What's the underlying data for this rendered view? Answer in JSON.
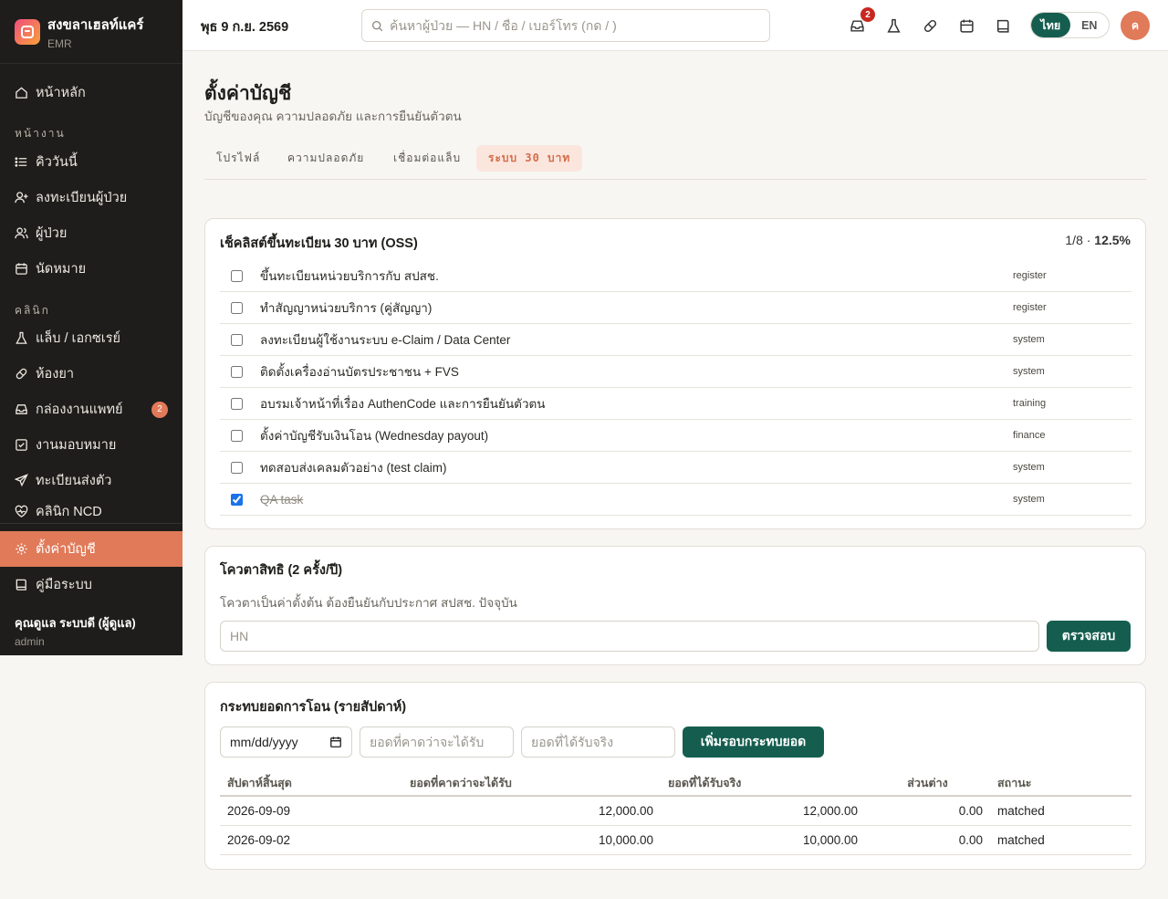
{
  "brand": {
    "name": "สงขลาเฮลท์แคร์",
    "sub": "EMR"
  },
  "sidebar": {
    "home": "หน้าหลัก",
    "section_work": "หน้างาน",
    "work_items": [
      "คิววันนี้",
      "ลงทะเบียนผู้ป่วย",
      "ผู้ป่วย",
      "นัดหมาย"
    ],
    "section_clinic": "คลินิก",
    "clinic_items": [
      "แล็บ / เอกซเรย์",
      "ห้องยา",
      "กล่องงานแพทย์",
      "งานมอบหมาย",
      "ทะเบียนส่งตัว",
      "คลินิก NCD"
    ],
    "inbox_badge": "2",
    "settings": "ตั้งค่าบัญชี",
    "manual": "คู่มือระบบ",
    "user_name": "คุณดูแล ระบบดี (ผู้ดูแล)",
    "user_role": "admin"
  },
  "topbar": {
    "date": "พุธ 9 ก.ย. 2569",
    "search_placeholder": "ค้นหาผู้ป่วย — HN / ชื่อ / เบอร์โทร (กด / )",
    "inbox_badge": "2",
    "lang_th": "ไทย",
    "lang_en": "EN",
    "avatar": "ค"
  },
  "page": {
    "title": "ตั้งค่าบัญชี",
    "subtitle": "บัญชีของคุณ ความปลอดภัย และการยืนยันตัวตน",
    "tabs": [
      "โปรไฟล์",
      "ความปลอดภัย",
      "เชื่อมต่อแล็บ",
      "ระบบ 30 บาท"
    ]
  },
  "checklist": {
    "title": "เช็คลิสต์ขึ้นทะเบียน 30 บาท (OSS)",
    "progress_count": "1/8 ·",
    "progress_pct": "12.5%",
    "items": [
      {
        "label": "ขึ้นทะเบียนหน่วยบริการกับ สปสช.",
        "tag": "register",
        "done": false
      },
      {
        "label": "ทำสัญญาหน่วยบริการ (คู่สัญญา)",
        "tag": "register",
        "done": false
      },
      {
        "label": "ลงทะเบียนผู้ใช้งานระบบ e-Claim / Data Center",
        "tag": "system",
        "done": false
      },
      {
        "label": "ติดตั้งเครื่องอ่านบัตรประชาชน + FVS",
        "tag": "system",
        "done": false
      },
      {
        "label": "อบรมเจ้าหน้าที่เรื่อง AuthenCode และการยืนยันตัวตน",
        "tag": "training",
        "done": false
      },
      {
        "label": "ตั้งค่าบัญชีรับเงินโอน (Wednesday payout)",
        "tag": "finance",
        "done": false
      },
      {
        "label": "ทดสอบส่งเคลมตัวอย่าง (test claim)",
        "tag": "system",
        "done": false
      },
      {
        "label": "QA task",
        "tag": "system",
        "done": true
      }
    ]
  },
  "quota": {
    "title": "โควตาสิทธิ (2 ครั้ง/ปี)",
    "note": "โควตาเป็นค่าตั้งต้น ต้องยืนยันกับประกาศ สปสช. ปัจจุบัน",
    "hn_placeholder": "HN",
    "check_button": "ตรวจสอบ"
  },
  "recon": {
    "title": "กระทบยอดการโอน (รายสัปดาห์)",
    "date_placeholder": "mm/dd/yyyy",
    "expected_placeholder": "ยอดที่คาดว่าจะได้รับ",
    "actual_placeholder": "ยอดที่ได้รับจริง",
    "add_button": "เพิ่มรอบกระทบยอด",
    "headers": [
      "สัปดาห์สิ้นสุด",
      "ยอดที่คาดว่าจะได้รับ",
      "ยอดที่ได้รับจริง",
      "ส่วนต่าง",
      "สถานะ"
    ],
    "rows": [
      [
        "2026-09-09",
        "12,000.00",
        "12,000.00",
        "0.00",
        "matched"
      ],
      [
        "2026-09-02",
        "10,000.00",
        "10,000.00",
        "0.00",
        "matched"
      ]
    ]
  },
  "colors": {
    "accent": "#e07a59",
    "primary": "#155e4f",
    "sidebar_bg": "#1e1d1b"
  }
}
